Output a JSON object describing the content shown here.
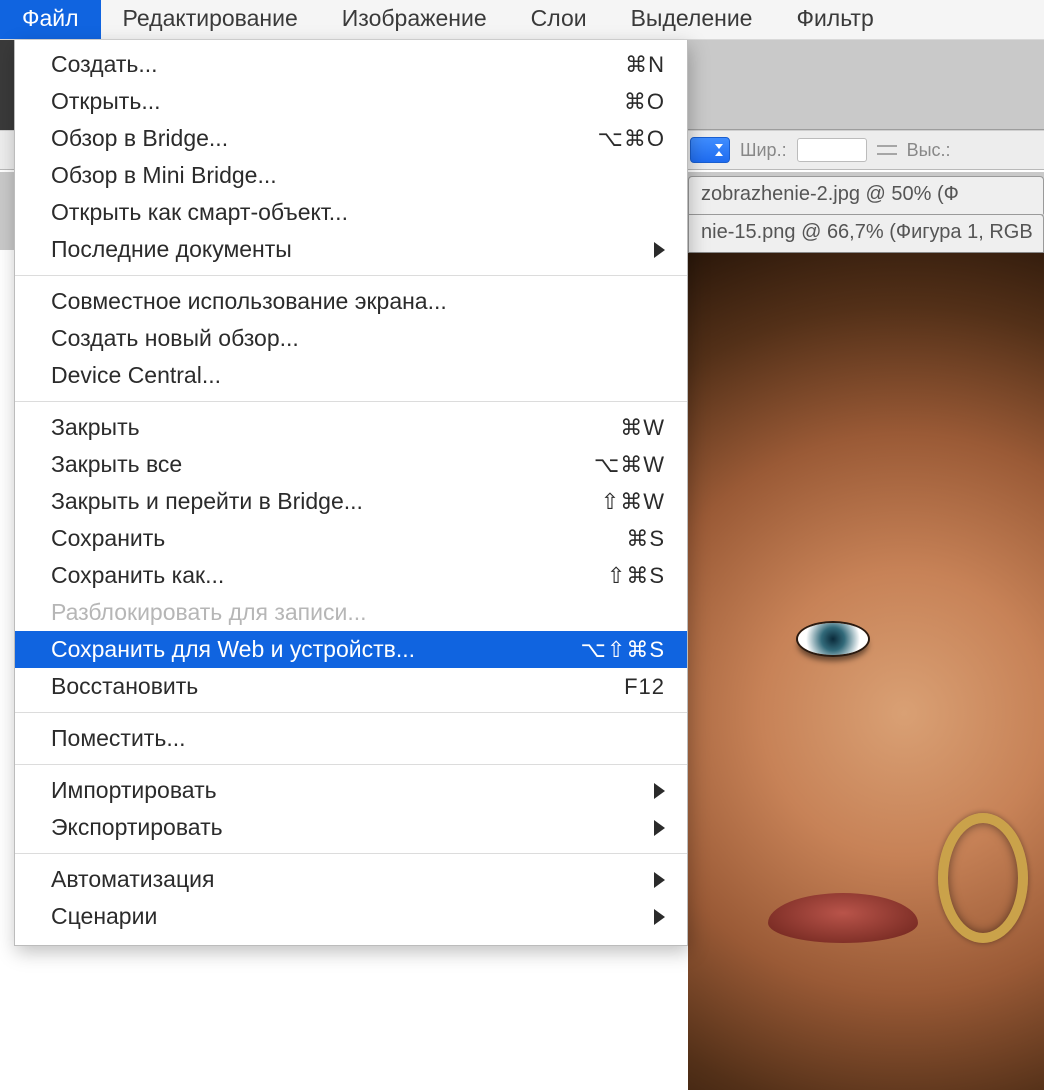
{
  "menubar": {
    "items": [
      {
        "label": "Файл",
        "active": true
      },
      {
        "label": "Редактирование"
      },
      {
        "label": "Изображение"
      },
      {
        "label": "Слои"
      },
      {
        "label": "Выделение"
      },
      {
        "label": "Фильтр"
      }
    ]
  },
  "options_bar": {
    "width_label": "Шир.:",
    "height_label": "Выс.:"
  },
  "doc_tabs": {
    "items": [
      {
        "title": "zobrazhenie-2.jpg @ 50% (Ф"
      },
      {
        "title": "nie-15.png @ 66,7% (Фигура 1, RGB"
      }
    ]
  },
  "file_menu": {
    "groups": [
      [
        {
          "label": "Создать...",
          "shortcut": "⌘N"
        },
        {
          "label": "Открыть...",
          "shortcut": "⌘O"
        },
        {
          "label": "Обзор в Bridge...",
          "shortcut": "⌥⌘O"
        },
        {
          "label": "Обзор в Mini Bridge..."
        },
        {
          "label": "Открыть как смарт-объект..."
        },
        {
          "label": "Последние документы",
          "submenu": true
        }
      ],
      [
        {
          "label": "Совместное использование экрана..."
        },
        {
          "label": "Создать новый обзор..."
        },
        {
          "label": "Device Central..."
        }
      ],
      [
        {
          "label": "Закрыть",
          "shortcut": "⌘W"
        },
        {
          "label": "Закрыть все",
          "shortcut": "⌥⌘W"
        },
        {
          "label": "Закрыть и перейти в Bridge...",
          "shortcut": "⇧⌘W"
        },
        {
          "label": "Сохранить",
          "shortcut": "⌘S"
        },
        {
          "label": "Сохранить как...",
          "shortcut": "⇧⌘S"
        },
        {
          "label": "Разблокировать для записи...",
          "disabled": true
        },
        {
          "label": "Сохранить для Web и устройств...",
          "shortcut": "⌥⇧⌘S",
          "highlight": true
        },
        {
          "label": "Восстановить",
          "shortcut": "F12"
        }
      ],
      [
        {
          "label": "Поместить..."
        }
      ],
      [
        {
          "label": "Импортировать",
          "submenu": true
        },
        {
          "label": "Экспортировать",
          "submenu": true
        }
      ],
      [
        {
          "label": "Автоматизация",
          "submenu": true
        },
        {
          "label": "Сценарии",
          "submenu": true
        }
      ]
    ]
  }
}
